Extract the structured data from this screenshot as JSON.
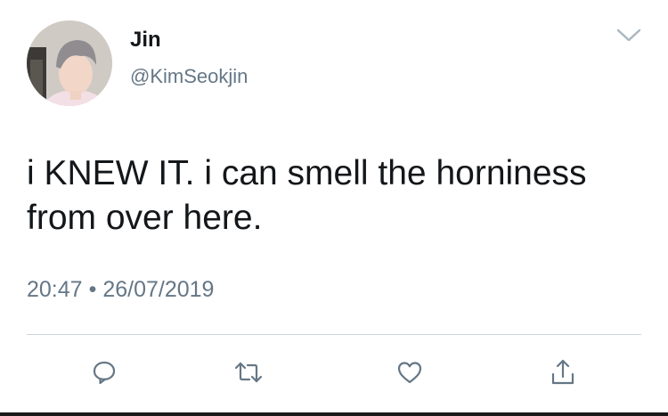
{
  "tweet": {
    "display_name": "Jin",
    "handle": "@KimSeokjin",
    "text": "i KNEW IT. i can smell the horniness from over here.",
    "time": "20:47",
    "separator": "•",
    "date": "26/07/2019"
  },
  "actions": [
    {
      "name": "reply",
      "icon": "reply-icon"
    },
    {
      "name": "retweet",
      "icon": "retweet-icon"
    },
    {
      "name": "like",
      "icon": "heart-icon"
    },
    {
      "name": "share",
      "icon": "share-icon"
    }
  ],
  "colors": {
    "text": "#14171a",
    "secondary": "#657786",
    "divider": "#ccd6dd",
    "icon": "#657786"
  }
}
